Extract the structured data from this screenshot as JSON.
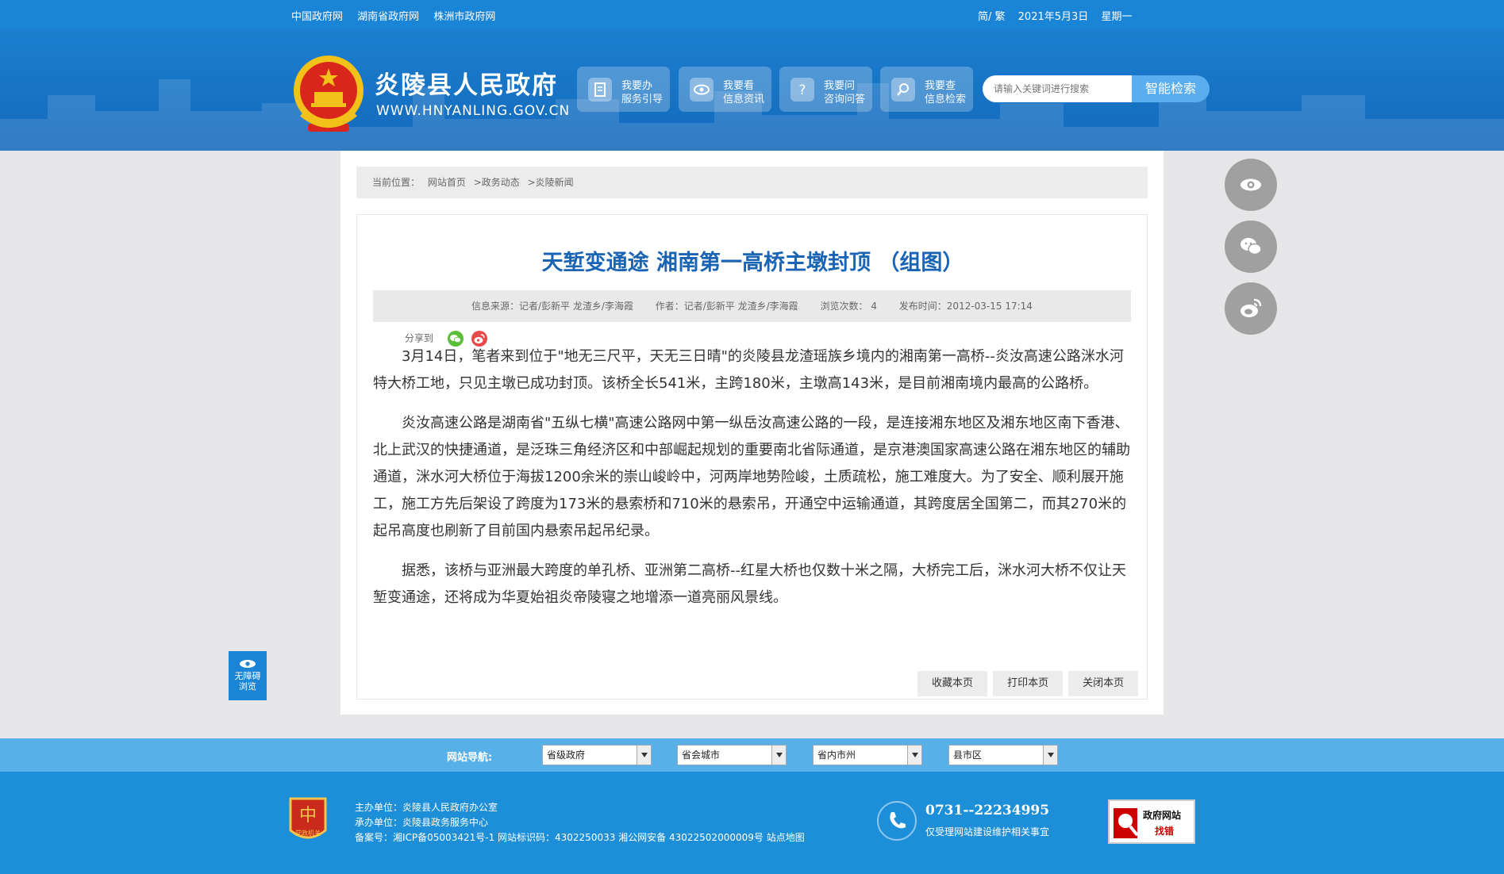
{
  "topbar": {
    "links": [
      "中国政府网",
      "湖南省政府网",
      "株洲市政府网"
    ],
    "lang_switch": "简/ 繁",
    "date": "2021年5月3日",
    "weekday": "星期一"
  },
  "header": {
    "site_title": "炎陵县人民政府",
    "site_domain": "WWW.HNYANLING.GOV.CN",
    "quick_buttons": [
      {
        "line1": "我要办",
        "line2": "服务引导",
        "icon": "document-icon"
      },
      {
        "line1": "我要看",
        "line2": "信息资讯",
        "icon": "eye-icon"
      },
      {
        "line1": "我要问",
        "line2": "咨询问答",
        "icon": "question-icon"
      },
      {
        "line1": "我要查",
        "line2": "信息检索",
        "icon": "search-icon"
      }
    ],
    "search_placeholder": "请输入关键词进行搜索",
    "search_button": "智能检索"
  },
  "breadcrumb": {
    "label": "当前位置：",
    "items": [
      "网站首页",
      ">政务动态",
      ">炎陵新闻"
    ]
  },
  "article": {
    "title": "天堑变通途 湘南第一高桥主墩封顶 （组图）",
    "meta": {
      "source": "信息来源：记者/彭新平 龙渣乡/李海霞",
      "author": "作者：记者/彭新平 龙渣乡/李海霞",
      "views": "浏览次数： 4",
      "published": "发布时间：2012-03-15 17:14"
    },
    "share_label": "分享到",
    "paragraphs": [
      "3月14日，笔者来到位于\"地无三尺平，天无三日晴\"的炎陵县龙渣瑶族乡境内的湘南第一高桥--炎汝高速公路洣水河特大桥工地，只见主墩已成功封顶。该桥全长541米，主跨180米，主墩高143米，是目前湘南境内最高的公路桥。",
      "炎汝高速公路是湖南省\"五纵七横\"高速公路网中第一纵岳汝高速公路的一段，是连接湘东地区及湘东地区南下香港、北上武汉的快捷通道，是泛珠三角经济区和中部崛起规划的重要南北省际通道，是京港澳国家高速公路在湘东地区的辅助通道，洣水河大桥位于海拔1200余米的崇山峻岭中，河两岸地势险峻，土质疏松，施工难度大。为了安全、顺利展开施工，施工方先后架设了跨度为173米的悬索桥和710米的悬索吊，开通空中运输通道，其跨度居全国第二，而其270米的起吊高度也刷新了目前国内悬索吊起吊纪录。",
      "据悉，该桥与亚洲最大跨度的单孔桥、亚洲第二高桥--红星大桥也仅数十米之隔，大桥完工后，洣水河大桥不仅让天堑变通途，还将成为华夏始祖炎帝陵寝之地增添一道亮丽风景线。"
    ],
    "actions": [
      "收藏本页",
      "打印本页",
      "关闭本页"
    ]
  },
  "accessibility": {
    "line1": "无障碍",
    "line2": "浏览"
  },
  "site_nav": {
    "label": "网站导航:",
    "selects": [
      "省级政府",
      "省会城市",
      "省内市州",
      "县市区"
    ]
  },
  "footer": {
    "sponsor": "主办单位：炎陵县人民政府办公室",
    "organizer": "承办单位：炎陵县政务服务中心",
    "record": "备案号：湘ICP备05003421号-1 网站标识码：4302250033 湘公网安备 43022502000009号 站点地图",
    "phone": "0731--22234995",
    "phone_note": "仅受理网站建设维护相关事宜",
    "find_error_line1": "政府网站",
    "find_error_line2": "找错",
    "party_logo_text": "党政机关"
  },
  "colors": {
    "brand_blue": "#1a84d6",
    "title_blue": "#1a64b5",
    "nav_blue": "#57b0e8",
    "footer_blue": "#1c8fd8"
  }
}
